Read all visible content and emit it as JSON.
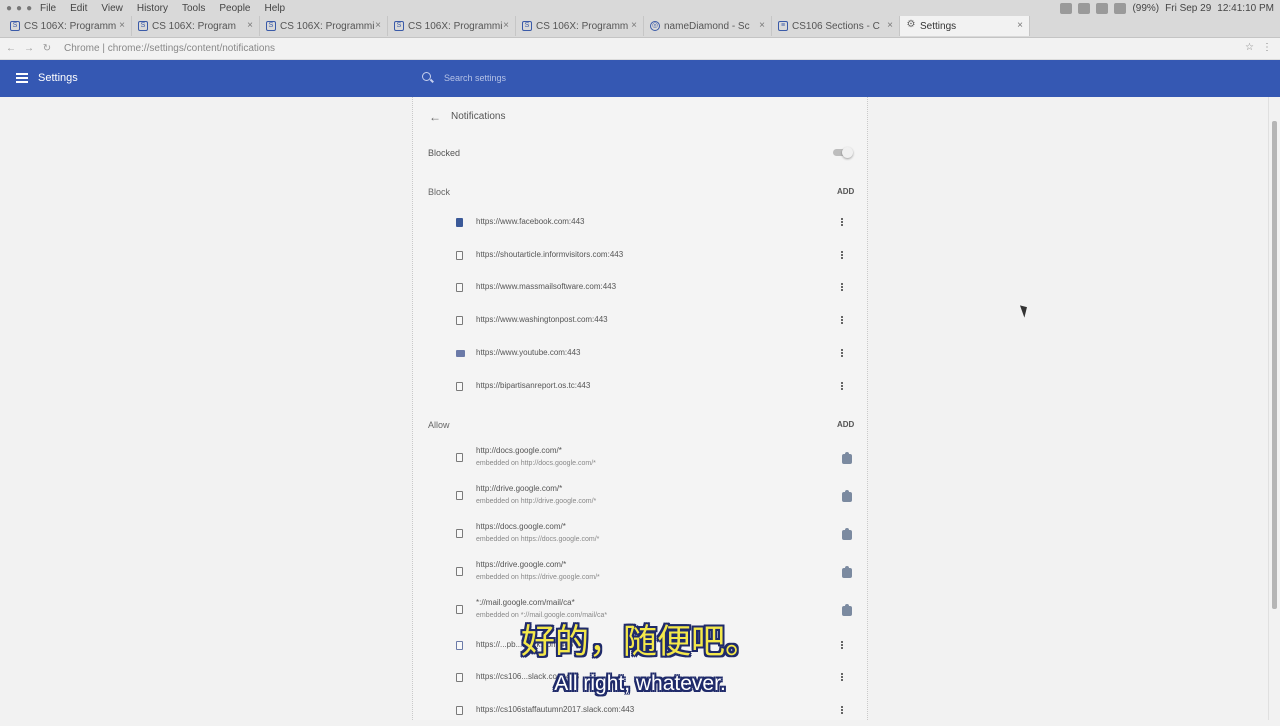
{
  "menubar": {
    "items": [
      "File",
      "Edit",
      "View",
      "History",
      "Tools",
      "People",
      "Help"
    ],
    "battery": "(99%)",
    "date": "Fri Sep 29",
    "time": "12:41:10 PM"
  },
  "tabs": [
    {
      "label": "CS 106X: Programm",
      "icon": "stanford-s-icon"
    },
    {
      "label": "CS 106X: Program",
      "icon": "stanford-s-icon"
    },
    {
      "label": "CS 106X: Programmi",
      "icon": "stanford-s-icon"
    },
    {
      "label": "CS 106X: Programmi",
      "icon": "stanford-s-icon"
    },
    {
      "label": "CS 106X: Programm",
      "icon": "stanford-s-icon"
    },
    {
      "label": "nameDiamond - Sc",
      "icon": "globe-icon"
    },
    {
      "label": "CS106 Sections - C",
      "icon": "document-icon"
    },
    {
      "label": "Settings",
      "icon": "gear-icon",
      "active": true
    }
  ],
  "address": {
    "url": "Chrome | chrome://settings/content/notifications"
  },
  "header": {
    "title": "Settings",
    "search_placeholder": "Search settings"
  },
  "page": {
    "title": "Notifications",
    "blocked_label": "Blocked",
    "blocked_toggle_on": false
  },
  "block_section": {
    "heading": "Block",
    "add_label": "ADD",
    "items": [
      {
        "url": "https://www.facebook.com:443",
        "icon": "facebook-icon"
      },
      {
        "url": "https://shoutarticle.informvisitors.com:443",
        "icon": "page-icon"
      },
      {
        "url": "https://www.massmailsoftware.com:443",
        "icon": "page-icon"
      },
      {
        "url": "https://www.washingtonpost.com:443",
        "icon": "page-icon"
      },
      {
        "url": "https://www.youtube.com:443",
        "icon": "youtube-icon"
      },
      {
        "url": "https://bipartisanreport.os.tc:443",
        "icon": "page-icon"
      }
    ]
  },
  "allow_section": {
    "heading": "Allow",
    "add_label": "ADD",
    "items": [
      {
        "url": "http://docs.google.com/*",
        "sub": "embedded on http://docs.google.com/*",
        "action": "puzzle-icon"
      },
      {
        "url": "http://drive.google.com/*",
        "sub": "embedded on http://drive.google.com/*",
        "action": "puzzle-icon"
      },
      {
        "url": "https://docs.google.com/*",
        "sub": "embedded on https://docs.google.com/*",
        "action": "puzzle-icon"
      },
      {
        "url": "https://drive.google.com/*",
        "sub": "embedded on https://drive.google.com/*",
        "action": "puzzle-icon"
      },
      {
        "url": "*://mail.google.com/mail/ca*",
        "sub": "embedded on *://mail.google.com/mail/ca*",
        "action": "puzzle-icon"
      },
      {
        "url": "https://...pb...slack.com:443",
        "sub": "",
        "action": "more-icon"
      },
      {
        "url": "https://cs106...slack.com:443",
        "sub": "",
        "action": "more-icon"
      },
      {
        "url": "https://cs106staffautumn2017.slack.com:443",
        "sub": "",
        "action": "more-icon"
      }
    ]
  },
  "subtitles": {
    "zh": "好的，随便吧。",
    "en": "All right, whatever."
  },
  "colors": {
    "header_blue": "#3558b3",
    "subtitle_yellow": "#f4e84a"
  }
}
